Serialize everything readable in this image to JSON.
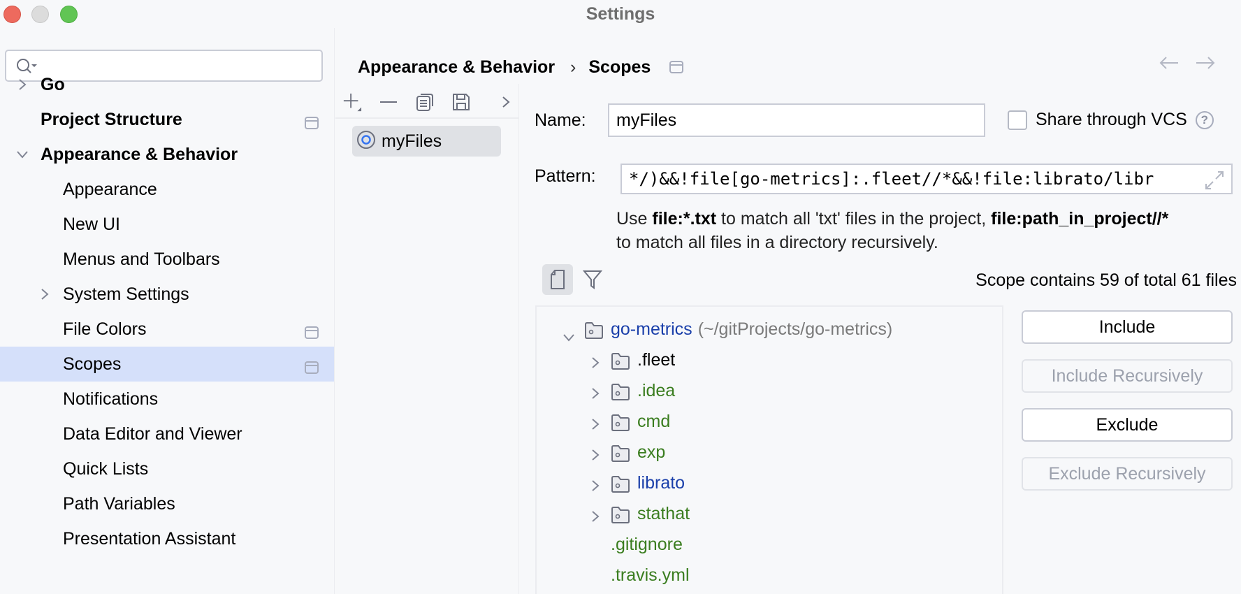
{
  "window": {
    "title": "Settings"
  },
  "colors": {
    "selection": "#d5e0fa",
    "included_file": "#3a7d1f",
    "project_root": "#1a3faa",
    "partially_included": "#1a3faa",
    "excluded_file": "#000000"
  },
  "sidebar": {
    "search": {
      "value": "",
      "placeholder": ""
    },
    "items": [
      {
        "label": "Go",
        "level": 0,
        "bold": true,
        "expander": "collapsed",
        "pin": false,
        "selected": false
      },
      {
        "label": "Project Structure",
        "level": 0,
        "bold": true,
        "expander": "none",
        "pin": true,
        "selected": false
      },
      {
        "label": "Appearance & Behavior",
        "level": 0,
        "bold": true,
        "expander": "expanded",
        "pin": false,
        "selected": false
      },
      {
        "label": "Appearance",
        "level": 1,
        "bold": false,
        "expander": "none",
        "pin": false,
        "selected": false
      },
      {
        "label": "New UI",
        "level": 1,
        "bold": false,
        "expander": "none",
        "pin": false,
        "selected": false
      },
      {
        "label": "Menus and Toolbars",
        "level": 1,
        "bold": false,
        "expander": "none",
        "pin": false,
        "selected": false
      },
      {
        "label": "System Settings",
        "level": 1,
        "bold": false,
        "expander": "collapsed",
        "pin": false,
        "selected": false
      },
      {
        "label": "File Colors",
        "level": 1,
        "bold": false,
        "expander": "none",
        "pin": true,
        "selected": false
      },
      {
        "label": "Scopes",
        "level": 1,
        "bold": false,
        "expander": "none",
        "pin": true,
        "selected": true
      },
      {
        "label": "Notifications",
        "level": 1,
        "bold": false,
        "expander": "none",
        "pin": false,
        "selected": false
      },
      {
        "label": "Data Editor and Viewer",
        "level": 1,
        "bold": false,
        "expander": "none",
        "pin": false,
        "selected": false
      },
      {
        "label": "Quick Lists",
        "level": 1,
        "bold": false,
        "expander": "none",
        "pin": false,
        "selected": false
      },
      {
        "label": "Path Variables",
        "level": 1,
        "bold": false,
        "expander": "none",
        "pin": false,
        "selected": false
      },
      {
        "label": "Presentation Assistant",
        "level": 1,
        "bold": false,
        "expander": "none",
        "pin": false,
        "selected": false
      }
    ]
  },
  "breadcrumb": {
    "parent": "Appearance & Behavior",
    "separator": "›",
    "current": "Scopes"
  },
  "scopes_list": {
    "toolbar": [
      "add-icon",
      "remove-icon",
      "copy-icon",
      "save-icon",
      "more-icon"
    ],
    "items": [
      {
        "label": "myFiles",
        "selected": true
      }
    ]
  },
  "scope_editor": {
    "name_label": "Name:",
    "name_value": "myFiles",
    "share_label": "Share through VCS",
    "share_checked": false,
    "pattern_label": "Pattern:",
    "pattern_value": "*/)&&!file[go-metrics]:.fleet//*&&!file:librato/libr",
    "hint": {
      "p1": "Use ",
      "b1": "file:*.txt",
      "p2": " to match all 'txt' files in the project, ",
      "b2": "file:path_in_project//*",
      "p3": "to match all files in a directory recursively."
    },
    "scope_count": "Scope contains 59 of total 61 files",
    "tree": [
      {
        "name": "go-metrics",
        "path": "(~/gitProjects/go-metrics)",
        "level": 0,
        "expander": "expanded",
        "folder": true,
        "status": "project_root"
      },
      {
        "name": ".fleet",
        "path": "",
        "level": 1,
        "expander": "collapsed",
        "folder": true,
        "status": "excluded_file"
      },
      {
        "name": ".idea",
        "path": "",
        "level": 1,
        "expander": "collapsed",
        "folder": true,
        "status": "included_file"
      },
      {
        "name": "cmd",
        "path": "",
        "level": 1,
        "expander": "collapsed",
        "folder": true,
        "status": "included_file"
      },
      {
        "name": "exp",
        "path": "",
        "level": 1,
        "expander": "collapsed",
        "folder": true,
        "status": "included_file"
      },
      {
        "name": "librato",
        "path": "",
        "level": 1,
        "expander": "collapsed",
        "folder": true,
        "status": "partially_included"
      },
      {
        "name": "stathat",
        "path": "",
        "level": 1,
        "expander": "collapsed",
        "folder": true,
        "status": "included_file"
      },
      {
        "name": ".gitignore",
        "path": "",
        "level": 1,
        "expander": "none",
        "folder": false,
        "status": "included_file"
      },
      {
        "name": ".travis.yml",
        "path": "",
        "level": 1,
        "expander": "none",
        "folder": false,
        "status": "included_file"
      }
    ],
    "buttons": [
      {
        "label": "Include",
        "enabled": true
      },
      {
        "label": "Include Recursively",
        "enabled": false
      },
      {
        "label": "Exclude",
        "enabled": true
      },
      {
        "label": "Exclude Recursively",
        "enabled": false
      }
    ]
  }
}
